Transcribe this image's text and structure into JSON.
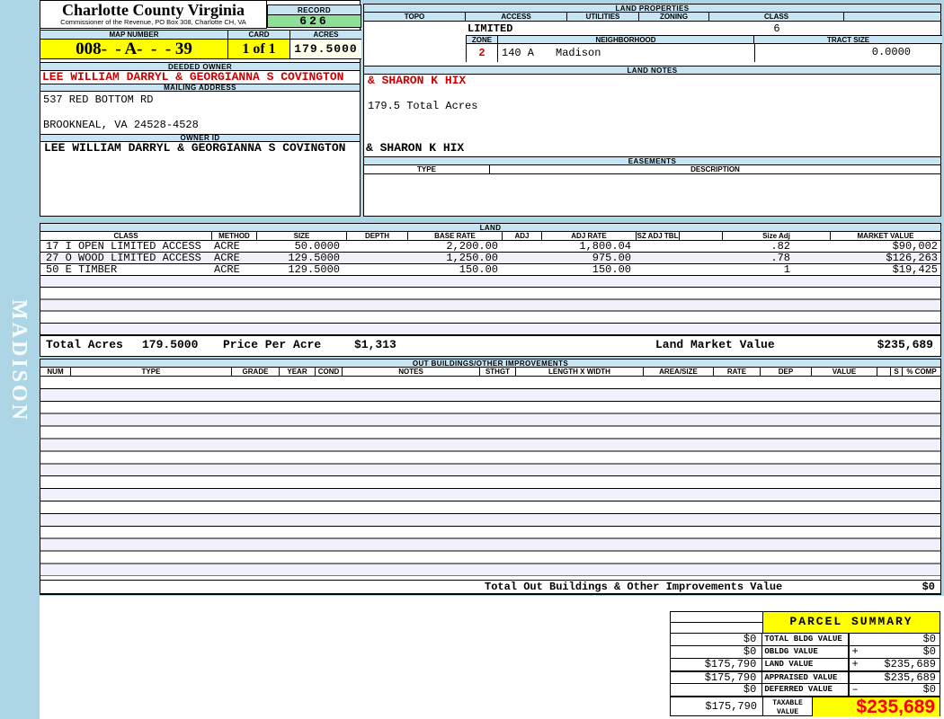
{
  "header": {
    "county": "Charlotte County Virginia",
    "commissioner": "Commissioner of the Revenue, PO  Box 308, Charlotte CH, VA",
    "record_label": "RECORD",
    "record_value": "626",
    "map_number_label": "MAP NUMBER",
    "map_number": "008-  - A-  -  - 39",
    "card_label": "CARD",
    "card_value": "1 of 1",
    "acres_label": "ACRES",
    "acres_value": "179.5000"
  },
  "watermark": "MADISON",
  "owner": {
    "deeded_owner_label": "DEEDED OWNER",
    "deeded_owner": "LEE WILLIAM DARRYL & GEORGIANNA S COVINGTON",
    "deeded_owner_overflow": "& SHARON K HIX",
    "mailing_address_label": "MAILING ADDRESS",
    "address_line1": "537 RED BOTTOM RD",
    "address_line2": "BROOKNEAL, VA 24528-4528",
    "owner_id_label": "OWNER ID",
    "owner_id": "LEE WILLIAM DARRYL & GEORGIANNA S COVINGTON",
    "owner_id_overflow": "& SHARON K HIX"
  },
  "land_properties": {
    "title": "LAND PROPERTIES",
    "columns": [
      "TOPO",
      "ACCESS",
      "UTILITIES",
      "ZONING",
      "CLASS"
    ],
    "access_value": "LIMITED",
    "class_value": "6",
    "zone_label": "ZONE",
    "zone_value": "2",
    "neighborhood_label": "NEIGHBORHOOD",
    "neighborhood_code": "140 A",
    "neighborhood_name": "Madison",
    "tract_size_label": "TRACT SIZE",
    "tract_size_value": "0.0000"
  },
  "land_notes": {
    "title": "LAND NOTES",
    "note": "179.5 Total Acres"
  },
  "easements": {
    "title": "EASEMENTS",
    "type_label": "TYPE",
    "description_label": "DESCRIPTION"
  },
  "land": {
    "title": "LAND",
    "columns": [
      "CLASS",
      "METHOD",
      "SIZE",
      "DEPTH",
      "BASE RATE",
      "ADJ",
      "ADJ RATE",
      "SZ ADJ TBL",
      "",
      "Size Adj",
      "MARKET VALUE"
    ],
    "rows": [
      {
        "class": "17 I OPEN LIMITED ACCESS",
        "method": "ACRE",
        "size": "50.0000",
        "depth": "",
        "base_rate": "2,200.00",
        "adj": "",
        "adj_rate": "1,800.04",
        "sz_adj_tbl": "",
        "size_adj": ".82",
        "market_value": "$90,002"
      },
      {
        "class": "27 O WOOD LIMITED ACCESS",
        "method": "ACRE",
        "size": "129.5000",
        "depth": "",
        "base_rate": "1,250.00",
        "adj": "",
        "adj_rate": "975.00",
        "sz_adj_tbl": "",
        "size_adj": ".78",
        "market_value": "$126,263"
      },
      {
        "class": "50 E TIMBER",
        "method": "ACRE",
        "size": "129.5000",
        "depth": "",
        "base_rate": "150.00",
        "adj": "",
        "adj_rate": "150.00",
        "sz_adj_tbl": "",
        "size_adj": "1",
        "market_value": "$19,425"
      }
    ],
    "total_acres_label": "Total Acres",
    "total_acres": "179.5000",
    "price_per_acre_label": "Price Per Acre",
    "price_per_acre": "$1,313",
    "land_market_value_label": "Land Market Value",
    "land_market_value": "$235,689"
  },
  "out_buildings": {
    "title": "OUT BUILDINGS/OTHER IMPROVEMENTS",
    "columns": [
      "NUM",
      "TYPE",
      "GRADE",
      "YEAR",
      "COND",
      "NOTES",
      "STHGT",
      "LENGTH X WIDTH",
      "AREA/SIZE",
      "RATE",
      "DEP",
      "VALUE",
      "",
      "S",
      "% COMP"
    ],
    "total_label": "Total Out Buildings & Other Improvements Value",
    "total_value": "$0"
  },
  "parcel_summary": {
    "title": "PARCEL SUMMARY",
    "rows": [
      {
        "left": "$0",
        "label": "TOTAL BLDG VALUE",
        "op": "",
        "value": "$0"
      },
      {
        "left": "$0",
        "label": "OBLDG VALUE",
        "op": "+",
        "value": "$0"
      },
      {
        "left": "$175,790",
        "label": "LAND VALUE",
        "op": "+",
        "value": "$235,689"
      },
      {
        "left": "$175,790",
        "label": "APPRAISED VALUE",
        "op": "",
        "value": "$235,689"
      },
      {
        "left": "$0",
        "label": "DEFERRED VALUE",
        "op": "–",
        "value": "$0"
      }
    ],
    "taxable": {
      "left": "$175,790",
      "label_line1": "TAXABLE",
      "label_line2": "VALUE",
      "value": "$235,689"
    }
  },
  "colors": {
    "page_bg": "#ACD6E6",
    "section_bar": "#C8E4F2",
    "record_green": "#90DF98",
    "highlight_yellow": "#FFFF00",
    "acres_ivory": "#FFFFEE",
    "owner_red": "#CC0000",
    "taxable_red": "#FF0000",
    "stripe": "#F0F1FA"
  }
}
